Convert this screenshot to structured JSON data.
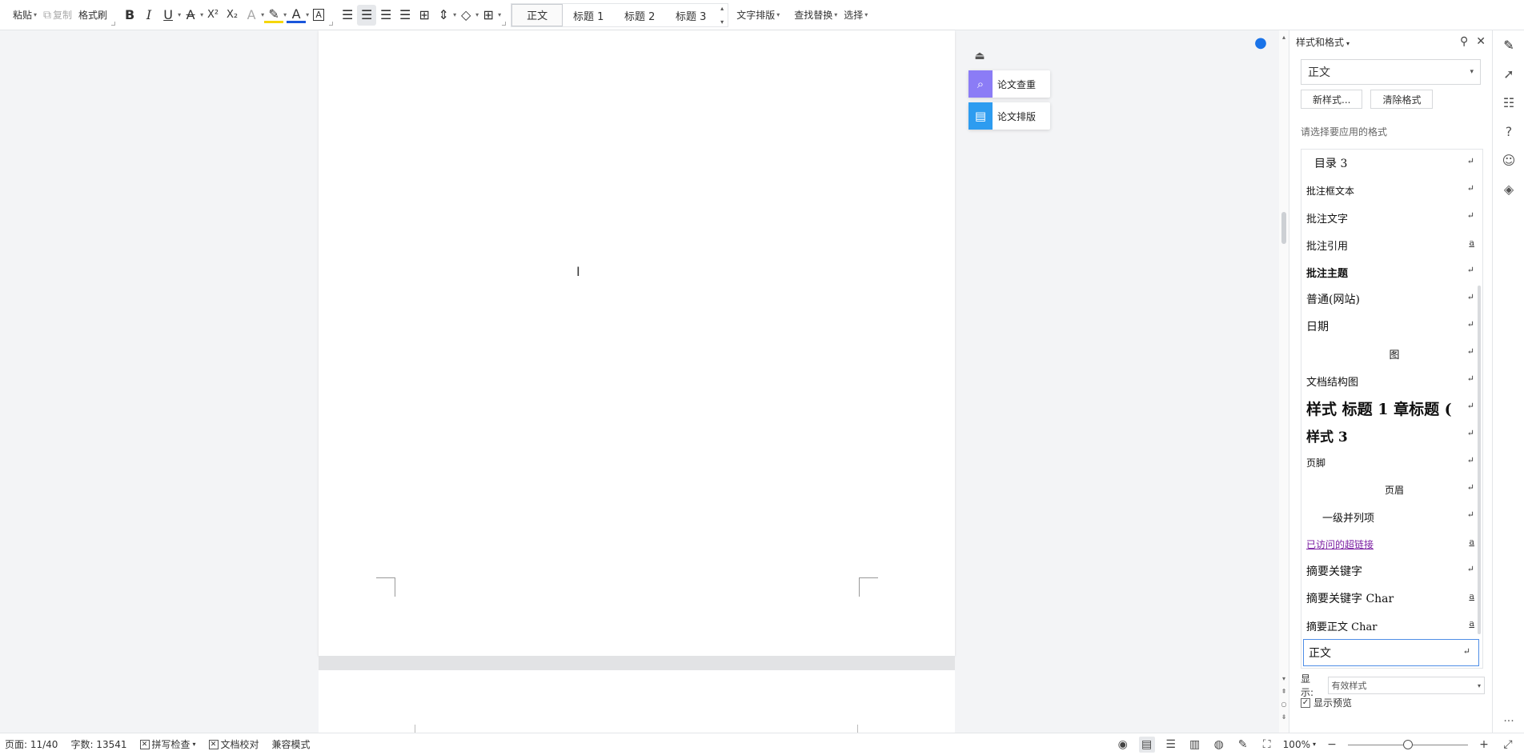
{
  "toolbar": {
    "paste": "粘贴",
    "copy": "复制",
    "format_painter": "格式刷",
    "styles": [
      {
        "label": "正文",
        "selected": true
      },
      {
        "label": "标题 1",
        "selected": false
      },
      {
        "label": "标题 2",
        "selected": false
      },
      {
        "label": "标题 3",
        "selected": false
      }
    ],
    "text_layout": "文字排版",
    "find_replace": "查找替换",
    "select": "选择",
    "bold": "B",
    "italic": "I",
    "underline": "U",
    "strike": "A",
    "superscript": "X²",
    "subscript": "X₂",
    "text_effect": "A",
    "font_color": "A",
    "char_border": "A"
  },
  "float_tools": {
    "paper_check": "论文查重",
    "paper_format": "论文排版",
    "paper_check_color": "#8b7cf6",
    "paper_format_color": "#2d9cf0"
  },
  "panel": {
    "title": "样式和格式",
    "current_style": "正文",
    "new_style": "新样式...",
    "clear_format": "清除格式",
    "apply_label": "请选择要应用的格式",
    "items": [
      {
        "label": "目录 3",
        "indent": 10,
        "size": 14,
        "weight": "normal",
        "align": "left",
        "ret": "↵"
      },
      {
        "label": "批注框文本",
        "indent": 0,
        "size": 12,
        "weight": "normal",
        "align": "left",
        "ret": "↵"
      },
      {
        "label": "批注文字",
        "indent": 0,
        "size": 13,
        "weight": "normal",
        "align": "left",
        "ret": "↵"
      },
      {
        "label": "批注引用",
        "indent": 0,
        "size": 13,
        "weight": "normal",
        "align": "left",
        "ret": "a"
      },
      {
        "label": "批注主题",
        "indent": 0,
        "size": 13,
        "weight": "bold",
        "align": "left",
        "ret": "↵"
      },
      {
        "label": "普通(网站)",
        "indent": 0,
        "size": 14,
        "weight": "normal",
        "align": "left",
        "ret": "↵"
      },
      {
        "label": "日期",
        "indent": 0,
        "size": 14,
        "weight": "normal",
        "align": "left",
        "ret": "↵"
      },
      {
        "label": "图",
        "indent": 0,
        "size": 13,
        "weight": "normal",
        "align": "center",
        "ret": "↵"
      },
      {
        "label": "文档结构图",
        "indent": 0,
        "size": 13,
        "weight": "normal",
        "align": "left",
        "ret": "↵"
      },
      {
        "label": "样式 标题 1 章标题 (",
        "indent": 0,
        "size": 19,
        "weight": "bold",
        "align": "left",
        "ret": "↵"
      },
      {
        "label": "样式 3",
        "indent": 0,
        "size": 17,
        "weight": "bold",
        "align": "left",
        "ret": "↵"
      },
      {
        "label": "页脚",
        "indent": 0,
        "size": 12,
        "weight": "normal",
        "align": "left",
        "ret": "↵"
      },
      {
        "label": "页眉",
        "indent": 0,
        "size": 12,
        "weight": "normal",
        "align": "center",
        "ret": "↵"
      },
      {
        "label": "一级并列项",
        "indent": 20,
        "size": 13,
        "weight": "normal",
        "align": "left",
        "ret": "↵"
      },
      {
        "label": "已访问的超链接",
        "indent": 0,
        "size": 12,
        "weight": "normal",
        "align": "left",
        "ret": "a",
        "link": true
      },
      {
        "label": "摘要关键字",
        "indent": 0,
        "size": 14,
        "weight": "normal",
        "align": "left",
        "ret": "↵"
      },
      {
        "label": "摘要关键字 Char",
        "indent": 0,
        "size": 14,
        "weight": "normal",
        "align": "left",
        "ret": "a"
      },
      {
        "label": "摘要正文 Char",
        "indent": 0,
        "size": 13,
        "weight": "normal",
        "align": "left",
        "ret": "a"
      },
      {
        "label": "正文",
        "indent": 0,
        "size": 14,
        "weight": "normal",
        "align": "left",
        "ret": "↵",
        "selected": true
      }
    ],
    "display_label": "显示:",
    "display_value": "有效样式",
    "show_preview": "显示预览",
    "visited_link_color": "#7b1fa2"
  },
  "status": {
    "page": "页面: 11/40",
    "words": "字数: 13541",
    "spell_check": "拼写检查",
    "doc_proof": "文档校对",
    "compat_mode": "兼容模式",
    "zoom": "100%",
    "zoom_level": 0.5
  }
}
